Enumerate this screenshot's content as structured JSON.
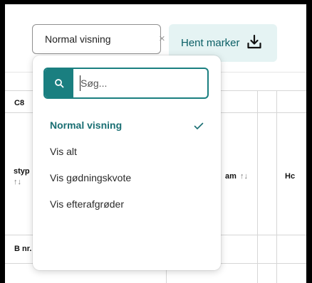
{
  "view_select": {
    "value": "Normal visning",
    "clear_glyph": "×"
  },
  "fetch_button": {
    "label": "Hent marker"
  },
  "dropdown": {
    "search": {
      "placeholder": "Søg...",
      "value": ""
    },
    "options": [
      {
        "label": "Normal visning",
        "selected": true
      },
      {
        "label": "Vis alt",
        "selected": false
      },
      {
        "label": "Vis gødningskvote",
        "selected": false
      },
      {
        "label": "Vis efterafgrøder",
        "selected": false
      }
    ]
  },
  "table_fragments": {
    "col_c8": "C8",
    "col_typ": "styp",
    "col_typ_sort": "↑↓",
    "col_am": "am",
    "col_am_sort": "↑↓",
    "col_h": "Hc",
    "row_label": "B nr."
  },
  "colors": {
    "accent": "#1a7f80",
    "accent_text": "#1a6f73",
    "button_bg": "#e5f3f3",
    "button_text": "#0b5f66"
  },
  "icons": {
    "search": "search-icon",
    "chevron": "chevron-down-icon",
    "download": "download-icon",
    "check": "check-icon",
    "clear": "clear-icon"
  }
}
